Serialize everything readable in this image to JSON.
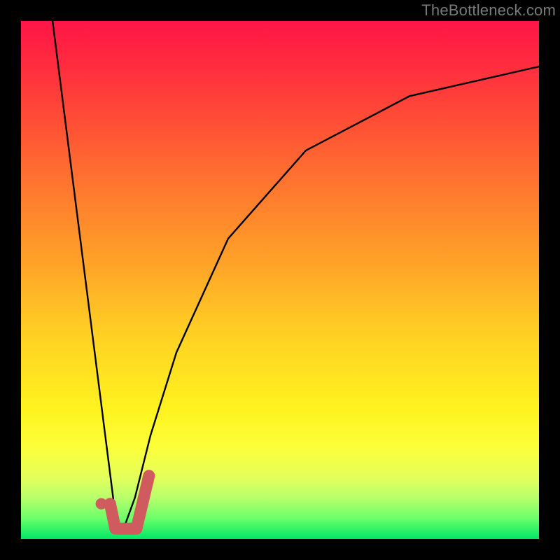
{
  "watermark": "TheBottleneck.com",
  "colors": {
    "page_bg": "#000000",
    "watermark": "#7a7a7a",
    "curve": "#000000",
    "marker_fill": "#cf5b5f",
    "marker_stroke": "#cf5b5f"
  },
  "chart_data": {
    "type": "line",
    "title": "",
    "xlabel": "",
    "ylabel": "",
    "xlim": [
      0,
      100
    ],
    "ylim": [
      0,
      100
    ],
    "series": [
      {
        "name": "falling-line",
        "x": [
          6.1,
          18.2
        ],
        "values": [
          100,
          4.7
        ]
      },
      {
        "name": "rising-curve",
        "x": [
          19.6,
          22,
          25,
          30,
          40,
          55,
          75,
          100
        ],
        "values": [
          1.4,
          8,
          20,
          36,
          58,
          75,
          85.5,
          91.2
        ]
      }
    ],
    "markers": [
      {
        "name": "dot",
        "shape": "circle",
        "x": 15.5,
        "y": 6.8,
        "r_pct": 1.1
      },
      {
        "name": "check-tail",
        "shape": "polyline",
        "points": [
          [
            17.2,
            6.8
          ],
          [
            18.2,
            2.0
          ],
          [
            22.3,
            2.0
          ],
          [
            24.7,
            12.2
          ]
        ],
        "stroke_width_pct": 2.3
      }
    ]
  }
}
